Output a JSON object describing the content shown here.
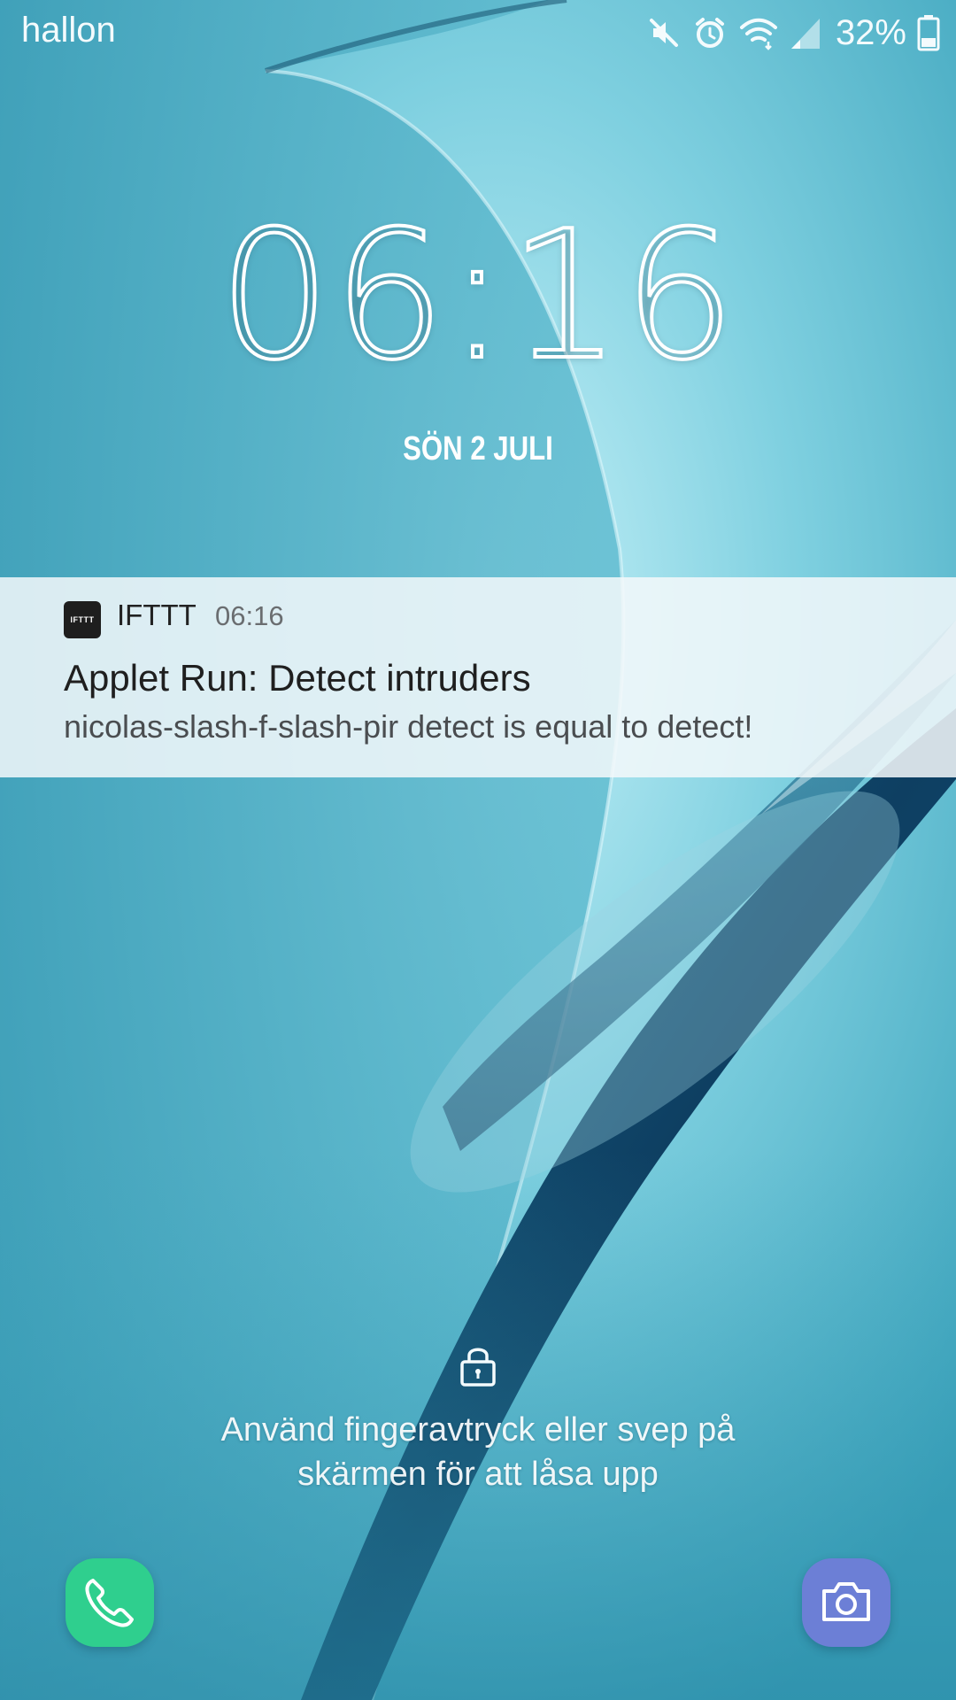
{
  "status_bar": {
    "carrier": "hallon",
    "battery_percent": "32%",
    "icons": [
      "mute-icon",
      "alarm-icon",
      "wifi-icon",
      "signal-icon",
      "battery-icon"
    ]
  },
  "lockscreen": {
    "time": "06:16",
    "date": "SÖN 2 JULI",
    "unlock_hint_line1": "Använd fingeravtryck eller svep på",
    "unlock_hint_line2": "skärmen för att låsa upp"
  },
  "notification": {
    "app_name": "IFTTT",
    "app_icon_text": "IFTTT",
    "time": "06:16",
    "title": "Applet Run: Detect intruders",
    "body": "nicolas-slash-f-slash-pir detect is equal to detect!"
  },
  "shortcuts": {
    "left_icon": "phone-icon",
    "right_icon": "camera-icon"
  },
  "colors": {
    "wallpaper_light": "#bfeef5",
    "wallpaper_mid": "#4fb3c8",
    "wallpaper_dark": "#0f4466",
    "phone_shortcut": "#2fcf8e",
    "camera_shortcut": "#6c7fd6"
  }
}
